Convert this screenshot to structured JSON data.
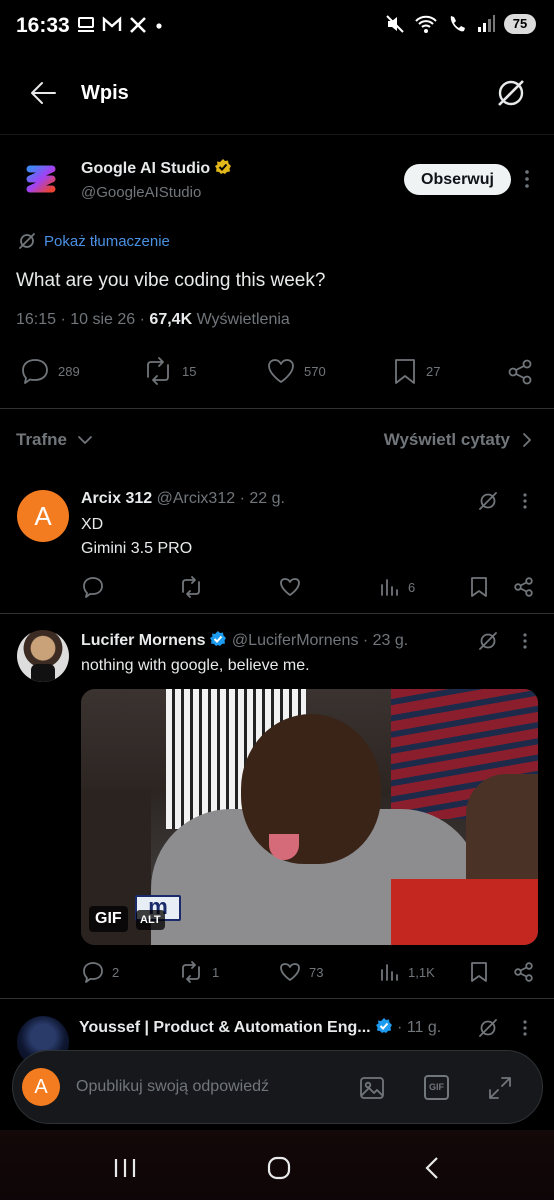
{
  "status_bar": {
    "time": "16:33",
    "battery": "75"
  },
  "header": {
    "title": "Wpis"
  },
  "post": {
    "author_name": "Google AI Studio",
    "author_handle": "@GoogleAIStudio",
    "follow_label": "Obserwuj",
    "translate_label": "Pokaż tłumaczenie",
    "text": "What are you vibe coding this week?",
    "meta_time": "16:15 · 10 sie 26 · ",
    "meta_views_count": "67,4K",
    "meta_views_label": " Wyświetlenia",
    "replies": "289",
    "reposts": "15",
    "likes": "570",
    "bookmarks": "27"
  },
  "sort_bar": {
    "left_label": "Trafne",
    "right_label": "Wyświetl cytaty"
  },
  "replies": [
    {
      "avatar_letter": "A",
      "name": "Arcix 312",
      "handle_time": "@Arcix312 · 22 g.",
      "line1": "XD",
      "line2": "Gimini 3.5 PRO",
      "views": "6"
    },
    {
      "name": "Lucifer Mornens",
      "handle_time": "@LuciferMornens · 23 g.",
      "text": "nothing with google, believe me.",
      "gif_badge": "GIF",
      "alt_badge": "ALT",
      "replies": "2",
      "reposts": "1",
      "likes": "73",
      "views": "1,1K"
    },
    {
      "name": "Youssef | Product & Automation Eng...",
      "time": "· 11 g."
    }
  ],
  "compose": {
    "avatar_letter": "A",
    "placeholder": "Opublikuj swoją odpowiedź",
    "gif_label": "GIF"
  },
  "colors": {
    "accent_link": "#4a90e2",
    "verified_blue": "#1d9bf0",
    "verified_gold": "#e2b719",
    "avatar_orange": "#f47c20"
  }
}
